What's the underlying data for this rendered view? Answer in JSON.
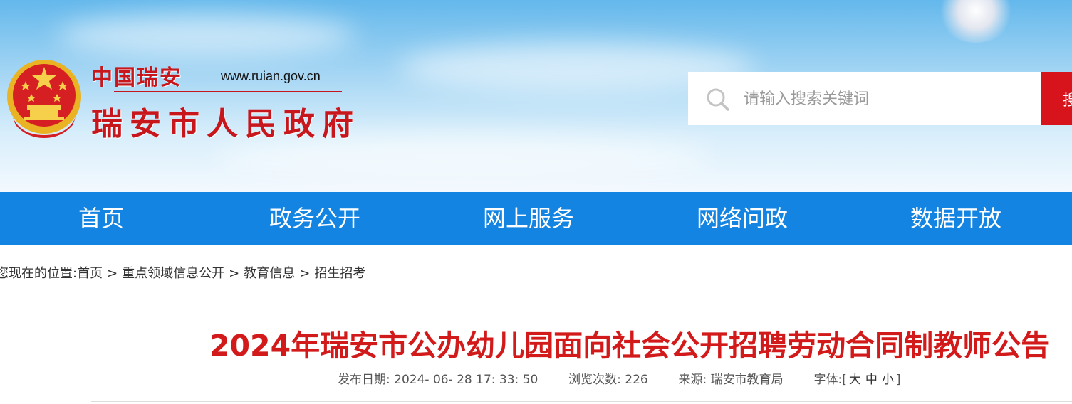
{
  "header": {
    "site_name_small": "中国瑞安",
    "site_url": "www.ruian.gov.cn",
    "site_name_big": "瑞安市人民政府",
    "search_placeholder": "请输入搜索关键词",
    "search_button": "搜"
  },
  "nav": {
    "items": [
      {
        "label": "首页"
      },
      {
        "label": "政务公开"
      },
      {
        "label": "网上服务"
      },
      {
        "label": "网络问政"
      },
      {
        "label": "数据开放"
      }
    ]
  },
  "breadcrumb": {
    "prefix": "您现在的位置:",
    "items": [
      "首页",
      "重点领域信息公开",
      "教育信息",
      "招生招考"
    ],
    "separator": ">"
  },
  "article": {
    "title": "2024年瑞安市公办幼儿园面向社会公开招聘劳动合同制教师公告",
    "publish_label": "发布日期:",
    "publish_value": "2024- 06- 28 17: 33: 50",
    "views_label": "浏览次数:",
    "views_value": "226",
    "source_label": "来源:",
    "source_value": "瑞安市教育局",
    "font_label": "字体:",
    "font_open": "[",
    "font_large": "大",
    "font_medium": "中",
    "font_small": "小",
    "font_close": "]"
  },
  "colors": {
    "brand_red": "#c8161d",
    "nav_blue": "#1384e2",
    "title_red": "#d21a1a"
  }
}
